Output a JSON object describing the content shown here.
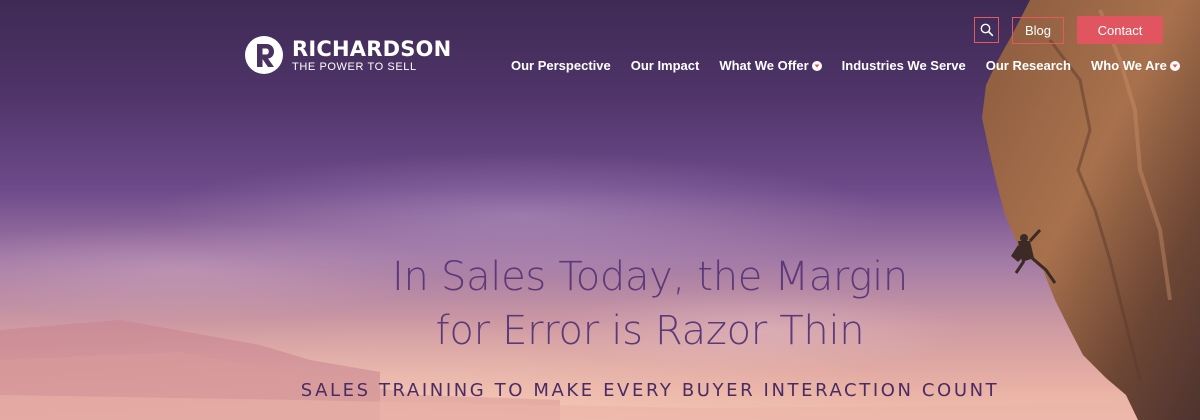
{
  "brand": {
    "name": "RICHARDSON",
    "tagline": "THE POWER TO SELL",
    "accent_color": "#e05560",
    "heading_color": "#5c3a79"
  },
  "top_actions": {
    "search_icon": "search-icon",
    "blog_label": "Blog",
    "contact_label": "Contact"
  },
  "nav": {
    "items": [
      {
        "label": "Our Perspective",
        "has_dropdown": false
      },
      {
        "label": "Our Impact",
        "has_dropdown": false
      },
      {
        "label": "What We Offer",
        "has_dropdown": true
      },
      {
        "label": "Industries We Serve",
        "has_dropdown": false
      },
      {
        "label": "Our Research",
        "has_dropdown": false
      },
      {
        "label": "Who We Are",
        "has_dropdown": true
      }
    ]
  },
  "hero": {
    "headline_line1": "In Sales Today, the Margin",
    "headline_line2": "for Error is Razor Thin",
    "subheadline": "SALES TRAINING TO MAKE EVERY BUYER INTERACTION COUNT"
  }
}
